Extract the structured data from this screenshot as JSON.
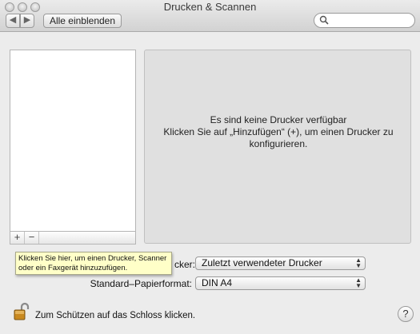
{
  "window": {
    "title": "Drucken & Scannen"
  },
  "toolbar": {
    "back_glyph": "◀",
    "forward_glyph": "▶",
    "show_all_label": "Alle einblenden",
    "search_placeholder": "",
    "search_value": ""
  },
  "printer_list": {
    "items": [],
    "add_label": "+",
    "remove_label": "−"
  },
  "detail": {
    "line1": "Es sind keine Drucker verfügbar",
    "line2": "Klicken Sie auf „Hinzufügen“ (+), um einen Drucker zu",
    "line3": "konfigurieren."
  },
  "tooltip": {
    "line1": "Klicken Sie hier, um einen Drucker, Scanner",
    "line2": "oder ein Faxgerät hinzuzufügen."
  },
  "settings": {
    "default_printer_label_visible": "cker:",
    "default_printer_value": "Zuletzt verwendeter Drucker",
    "paper_format_label": "Standard–Papierformat:",
    "paper_format_value": "DIN A4"
  },
  "footer": {
    "lock_text": "Zum Schützen auf das Schloss klicken.",
    "help_label": "?"
  },
  "icons": {
    "search": "search-icon",
    "lock": "unlocked-padlock-icon",
    "popup_arrows": "up-down-arrows-icon"
  },
  "colors": {
    "tooltip_bg": "#ffffc8",
    "pane_bg": "#e0e0e0",
    "window_bg": "#ececec"
  }
}
